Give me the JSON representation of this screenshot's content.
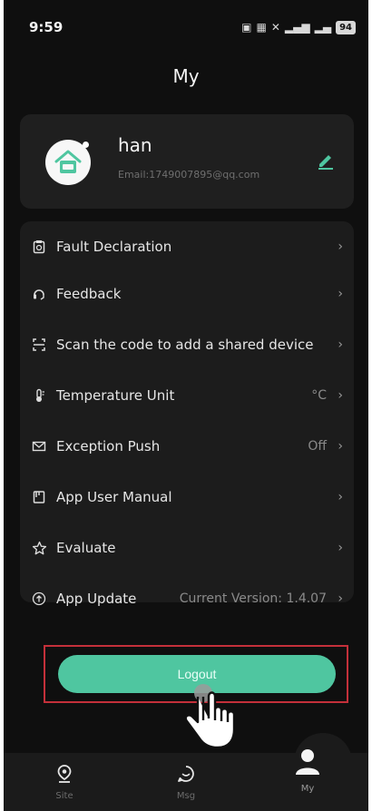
{
  "status_bar": {
    "time": "9:59",
    "battery": "94"
  },
  "header": {
    "title": "My"
  },
  "profile": {
    "username": "han",
    "email": "Email:1749007895@qq.com",
    "avatar_icon": "house-avatar-icon",
    "edit_icon": "pencil-icon"
  },
  "menu": {
    "items": [
      {
        "label": "Fault Declaration",
        "value": "",
        "icon": "clipboard-icon"
      },
      {
        "label": "Feedback",
        "value": "",
        "icon": "headset-icon"
      },
      {
        "label": "Scan the code to add a shared device",
        "value": "",
        "icon": "scan-icon"
      },
      {
        "label": "Temperature Unit",
        "value": "°C",
        "icon": "thermometer-icon"
      },
      {
        "label": "Exception Push",
        "value": "Off",
        "icon": "envelope-icon"
      },
      {
        "label": "App User Manual",
        "value": "",
        "icon": "manual-icon"
      },
      {
        "label": "Evaluate",
        "value": "",
        "icon": "star-icon"
      },
      {
        "label": "App Update",
        "value": "Current Version: 1.4.07",
        "icon": "upload-icon"
      }
    ]
  },
  "logout": {
    "label": "Logout"
  },
  "bottom_nav": {
    "items": [
      {
        "label": "Site",
        "icon": "location-pin-icon"
      },
      {
        "label": "Msg",
        "icon": "chat-bubble-icon"
      },
      {
        "label": "My",
        "icon": "user-icon"
      }
    ]
  },
  "colors": {
    "accent": "#4fc6a0",
    "background": "#0f0f0f",
    "card": "#1c1c1c",
    "highlight_frame": "#c4303a"
  }
}
